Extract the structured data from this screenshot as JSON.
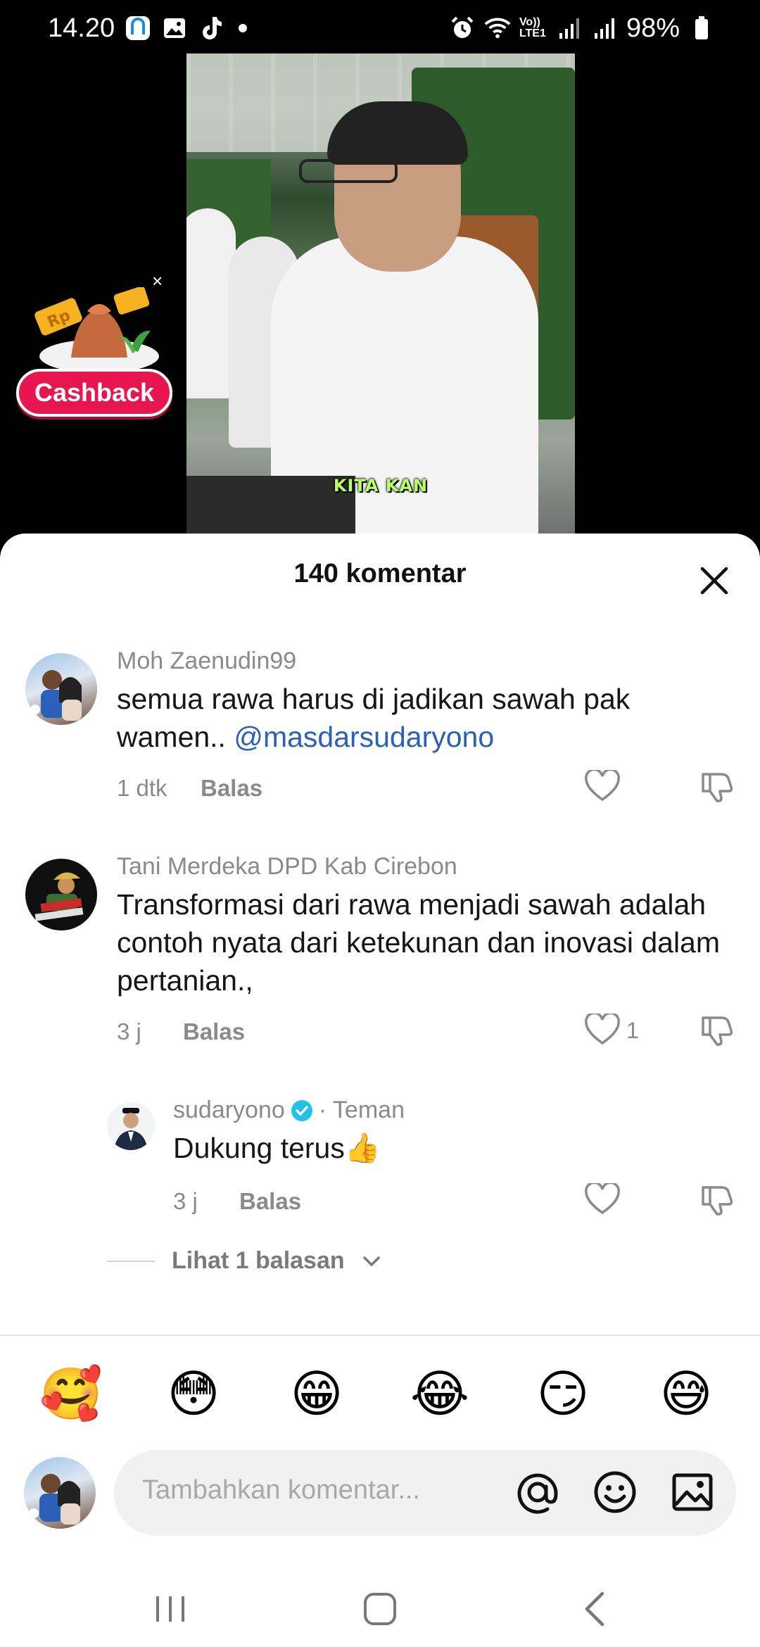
{
  "status_bar": {
    "time": "14.20",
    "network": "Vo)) LTE1",
    "battery": "98%"
  },
  "video": {
    "subtitle": "KITA KAN"
  },
  "promo": {
    "label": "Cashback",
    "close": "×"
  },
  "comments_sheet": {
    "title": "140 komentar",
    "comments": [
      {
        "username": "Moh Zaenudin99",
        "text": "semua rawa harus di jadikan sawah pak wamen.. ",
        "mention": "@masdarsudaryono",
        "time": "1 dtk",
        "reply_label": "Balas",
        "likes": ""
      },
      {
        "username": "Tani Merdeka DPD Kab Cirebon",
        "text": "Transformasi dari rawa menjadi sawah adalah contoh nyata dari ketekunan dan inovasi dalam pertanian.,",
        "time": "3 j",
        "reply_label": "Balas",
        "likes": "1"
      }
    ],
    "reply": {
      "username": "sudaryono",
      "relation": "· Teman",
      "text": "Dukung terus👍",
      "time": "3 j",
      "reply_label": "Balas"
    },
    "view_replies": "Lihat 1 balasan"
  },
  "emoji_bar": [
    "🥰",
    "😳",
    "😁",
    "😂",
    "😏",
    "😅"
  ],
  "input": {
    "placeholder": "Tambahkan komentar..."
  },
  "colors": {
    "mention": "#2b5fb8",
    "cashback": "#e8164f",
    "verified": "#20c3e6"
  }
}
